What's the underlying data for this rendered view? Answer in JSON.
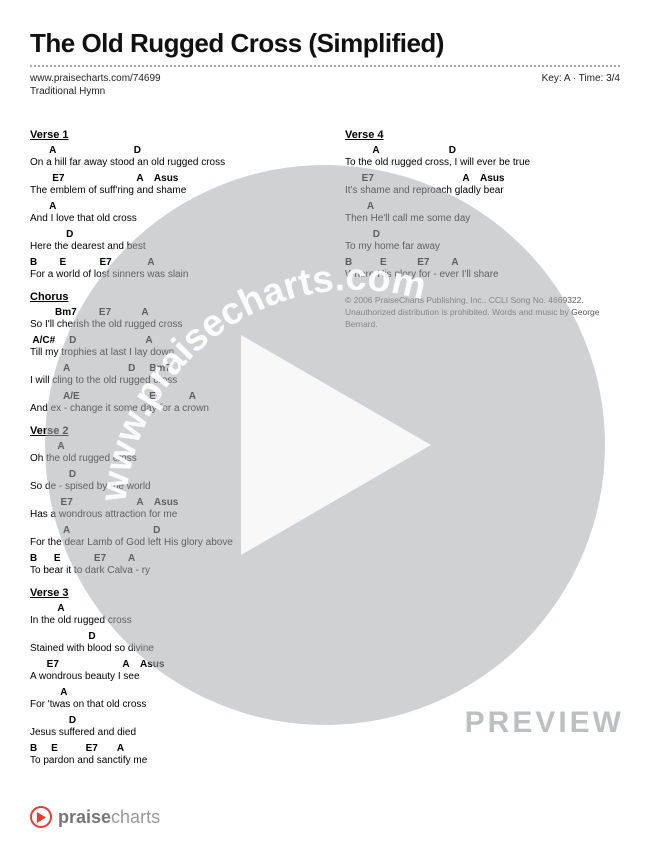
{
  "title": "The Old Rugged Cross (Simplified)",
  "meta": {
    "url": "www.praisecharts.com/74699",
    "key_time": "Key: A · Time: 3/4",
    "subtitle": "Traditional Hymn"
  },
  "left": {
    "verse1": {
      "heading": "Verse 1",
      "lines": [
        {
          "c": "       A                            D",
          "l": "On a hill far away stood an old rugged cross"
        },
        {
          "c": "        E7                          A    Asus",
          "l": "The emblem of suff'ring and shame"
        },
        {
          "c": "       A",
          "l": "And I love that old cross"
        },
        {
          "c": "             D",
          "l": "Here the dearest and best"
        },
        {
          "c": "B        E            E7             A",
          "l": "For a world of lost sinners was slain"
        }
      ]
    },
    "chorus": {
      "heading": "Chorus",
      "lines": [
        {
          "c": "         Bm7        E7           A",
          "l": "So I'll cherish the old rugged cross"
        },
        {
          "c": " A/C#     D                         A",
          "l": " Till  my trophies at last I lay down"
        },
        {
          "c": "            A                     D     Bm7",
          "l": "I will cling to the old rugged cross"
        },
        {
          "c": "            A/E                         E7          A",
          "l": "And ex - change it some day for a crown"
        }
      ]
    },
    "verse2": {
      "heading": "Verse 2",
      "lines": [
        {
          "c": "          A",
          "l": "Oh the old rugged cross"
        },
        {
          "c": "              D",
          "l": "So de - spised by the world"
        },
        {
          "c": "           E7                       A    Asus",
          "l": "Has a wondrous attraction for me"
        },
        {
          "c": "            A                              D",
          "l": "For the dear Lamb of God left His glory above"
        },
        {
          "c": "B      E            E7        A",
          "l": "To bear it to dark Calva - ry"
        }
      ]
    },
    "verse3": {
      "heading": "Verse 3",
      "lines": [
        {
          "c": "          A",
          "l": "In the old rugged cross"
        },
        {
          "c": "                     D",
          "l": "Stained with blood so divine"
        },
        {
          "c": "      E7                       A    Asus",
          "l": "A wondrous beauty I see"
        },
        {
          "c": "           A",
          "l": "For 'twas on that old cross"
        },
        {
          "c": "              D",
          "l": "Jesus suffered and died"
        },
        {
          "c": "B     E          E7       A",
          "l": "To pardon and sanctify me"
        }
      ]
    }
  },
  "right": {
    "verse4": {
      "heading": "Verse 4",
      "lines": [
        {
          "c": "          A                         D",
          "l": "To the old rugged cross, I will ever be true"
        },
        {
          "c": "      E7                                A    Asus",
          "l": "It's shame and reproach gladly bear"
        },
        {
          "c": "        A",
          "l": "Then He'll call me some day"
        },
        {
          "c": "          D",
          "l": "To my home far away"
        },
        {
          "c": "B          E           E7        A",
          "l": "Where His glory for - ever I'll share"
        }
      ]
    },
    "copyright": "© 2006 PraiseCharts Publishing, Inc.. CCLI Song No. 4669322. Unauthorized distribution is prohibited. Words and music by George Bernard."
  },
  "watermark_url": "www.praisecharts.com",
  "preview_label": "PREVIEW",
  "footer": {
    "brand_bold": "praise",
    "brand_light": "charts"
  }
}
